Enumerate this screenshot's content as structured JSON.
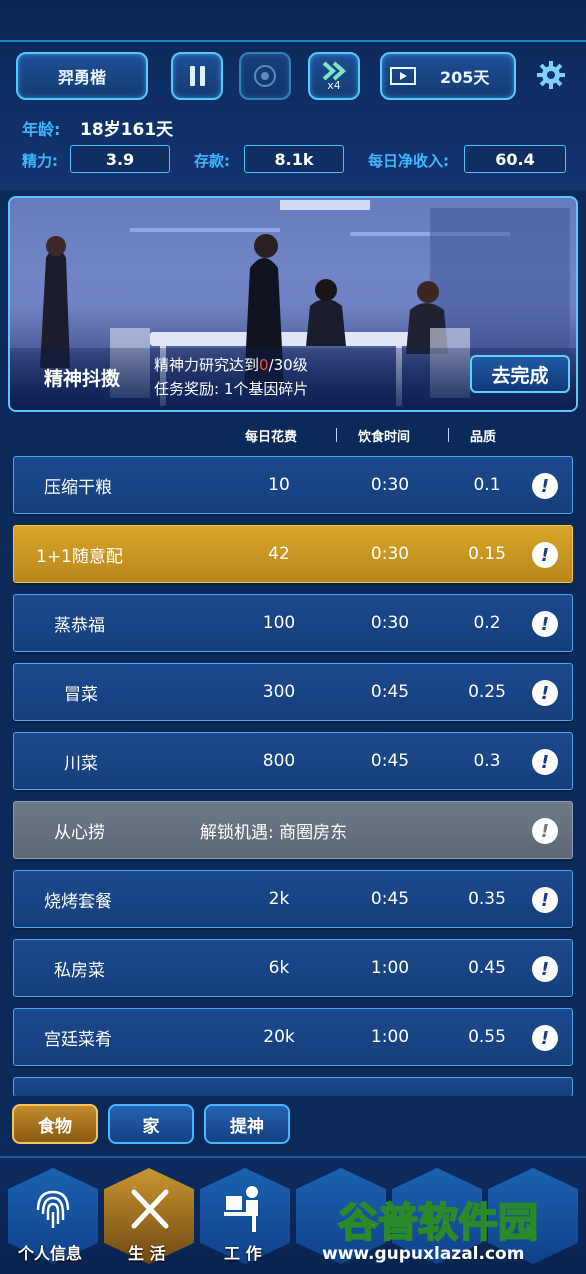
{
  "header": {
    "player_name": "羿勇楷",
    "speed_label": "x4",
    "day_count": "205天"
  },
  "stats": {
    "age_label": "年龄:",
    "age_value": "18岁161天",
    "energy_label": "精力:",
    "energy_value": "3.9",
    "savings_label": "存款:",
    "savings_value": "8.1k",
    "income_label": "每日净收入:",
    "income_value": "60.4"
  },
  "task": {
    "title": "精神抖擞",
    "requirement_prefix": "精神力研究达到",
    "requirement_current": "0",
    "requirement_suffix": "/30级",
    "reward": "任务奖励: 1个基因碎片",
    "button_label": "去完成"
  },
  "columns": {
    "cost": "每日花费",
    "time": "饮食时间",
    "quality": "品质"
  },
  "food_items": [
    {
      "name": "压缩干粮",
      "cost": "10",
      "time": "0:30",
      "quality": "0.1"
    },
    {
      "name": "1+1随意配",
      "cost": "42",
      "time": "0:30",
      "quality": "0.15"
    },
    {
      "name": "蒸恭福",
      "cost": "100",
      "time": "0:30",
      "quality": "0.2"
    },
    {
      "name": "冒菜",
      "cost": "300",
      "time": "0:45",
      "quality": "0.25"
    },
    {
      "name": "川菜",
      "cost": "800",
      "time": "0:45",
      "quality": "0.3"
    },
    {
      "name": "从心捞",
      "unlock": "解锁机遇: 商圈房东"
    },
    {
      "name": "烧烤套餐",
      "cost": "2k",
      "time": "0:45",
      "quality": "0.35"
    },
    {
      "name": "私房菜",
      "cost": "6k",
      "time": "1:00",
      "quality": "0.45"
    },
    {
      "name": "宫廷菜肴",
      "cost": "20k",
      "time": "1:00",
      "quality": "0.55"
    }
  ],
  "info_glyph": "!",
  "tabs": [
    "食物",
    "家",
    "提神"
  ],
  "nav": [
    "个人信息",
    "生 活",
    "工 作"
  ],
  "watermark": {
    "title": "谷普软件园",
    "url": "www.gupuxlazal.com"
  }
}
